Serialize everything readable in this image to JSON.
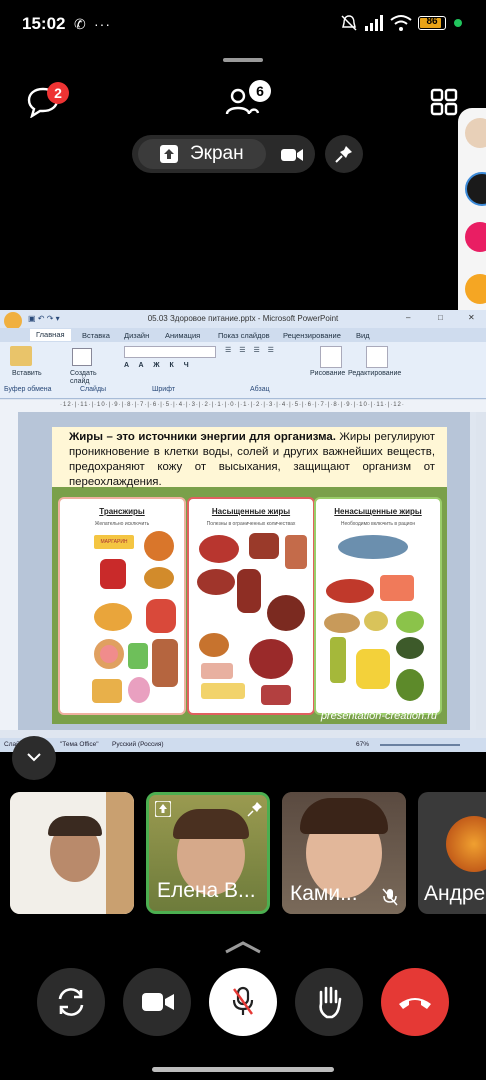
{
  "status_bar": {
    "time": "15:02",
    "battery": "86"
  },
  "top_bar": {
    "chat_badge": "2",
    "participants_count": "6"
  },
  "screen_share": {
    "label": "Экран"
  },
  "powerpoint": {
    "window_title": "05.03 Здоровое питание.pptx - Microsoft PowerPoint",
    "tabs": [
      "Главная",
      "Вставка",
      "Дизайн",
      "Анимация",
      "Показ слайдов",
      "Рецензирование",
      "Вид"
    ],
    "ribbon": {
      "paste": "Вставить",
      "new_slide": "Создать слайд",
      "clipboard": "Буфер обмена",
      "slides": "Слайды",
      "font": "Шрифт",
      "paragraph": "Абзац",
      "drawing": "Рисование",
      "editing": "Редактирование"
    },
    "slide_text_bold": "Жиры – это источники энергии для организма.",
    "slide_text_rest": " Жиры регулируют проникновение в клетки воды, солей и других важнейших веществ, предохраняют кожу от высыхания, защищают организм от переохлаждения.",
    "cards": [
      {
        "title": "Трансжиры",
        "subtitle": "Желательно исключить",
        "label": "МАРГАРИН"
      },
      {
        "title": "Насыщенные жиры",
        "subtitle": "Полезны в ограниченных количествах"
      },
      {
        "title": "Ненасыщенные жиры",
        "subtitle": "Необходимо включить в рацион"
      }
    ],
    "watermark": "presentation-creation.ru",
    "statusbar": {
      "slide": "Слайд 6 из 12",
      "theme": "\"Тема Office\"",
      "language": "Русский (Россия)",
      "zoom": "67%"
    }
  },
  "participants": [
    {
      "name": ""
    },
    {
      "name": "Елена В..."
    },
    {
      "name": "Ками..."
    },
    {
      "name": "Андре"
    }
  ],
  "colors": {
    "end_call": "#e53935",
    "active_tile_border": "#4caf50",
    "badge": "#e53333"
  }
}
